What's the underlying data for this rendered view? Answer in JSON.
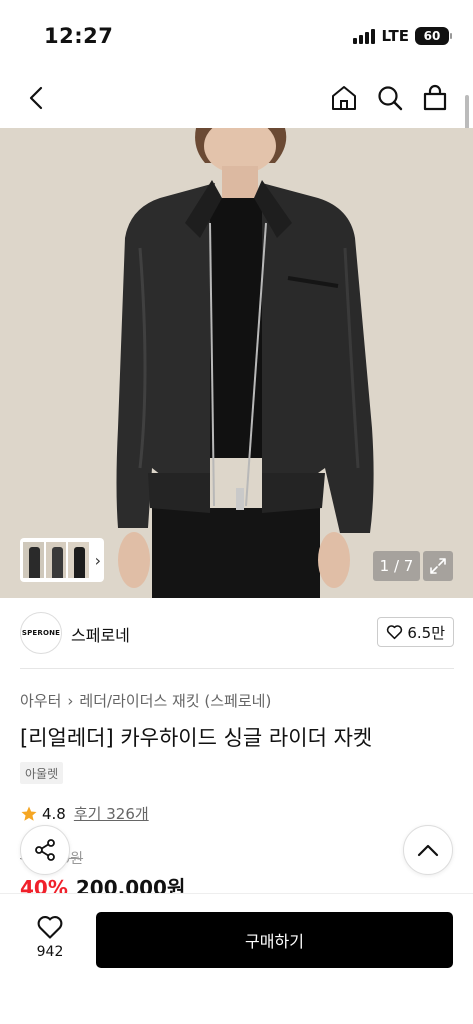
{
  "status_bar": {
    "time": "12:27",
    "network": "LTE",
    "battery": "60"
  },
  "nav": {
    "icons": [
      "back-arrow-icon",
      "home-icon",
      "search-icon",
      "shopping-bag-icon"
    ]
  },
  "gallery": {
    "page_indicator": "1 / 7",
    "icons": [
      "expand-icon",
      "chevron-right-icon"
    ]
  },
  "brand": {
    "logo_text": "SPERONE",
    "name": "스페로네",
    "likes": "6.5만"
  },
  "breadcrumb": {
    "items": [
      "아우터",
      "레더/라이더스 재킷 (스페로네)"
    ]
  },
  "product": {
    "title": "[리얼레더] 카우하이드 싱글 라이더 자켓",
    "tag": "아울렛",
    "rating": "4.8",
    "reviews": "후기 326개",
    "original_price": "--0,000원",
    "discount": "40%",
    "price": "200,000원"
  },
  "bottom_bar": {
    "wish_count": "942",
    "buy_label": "구매하기"
  },
  "colors": {
    "accent_red": "#f0212b",
    "primary_black": "#000000",
    "star": "#f5a623"
  }
}
